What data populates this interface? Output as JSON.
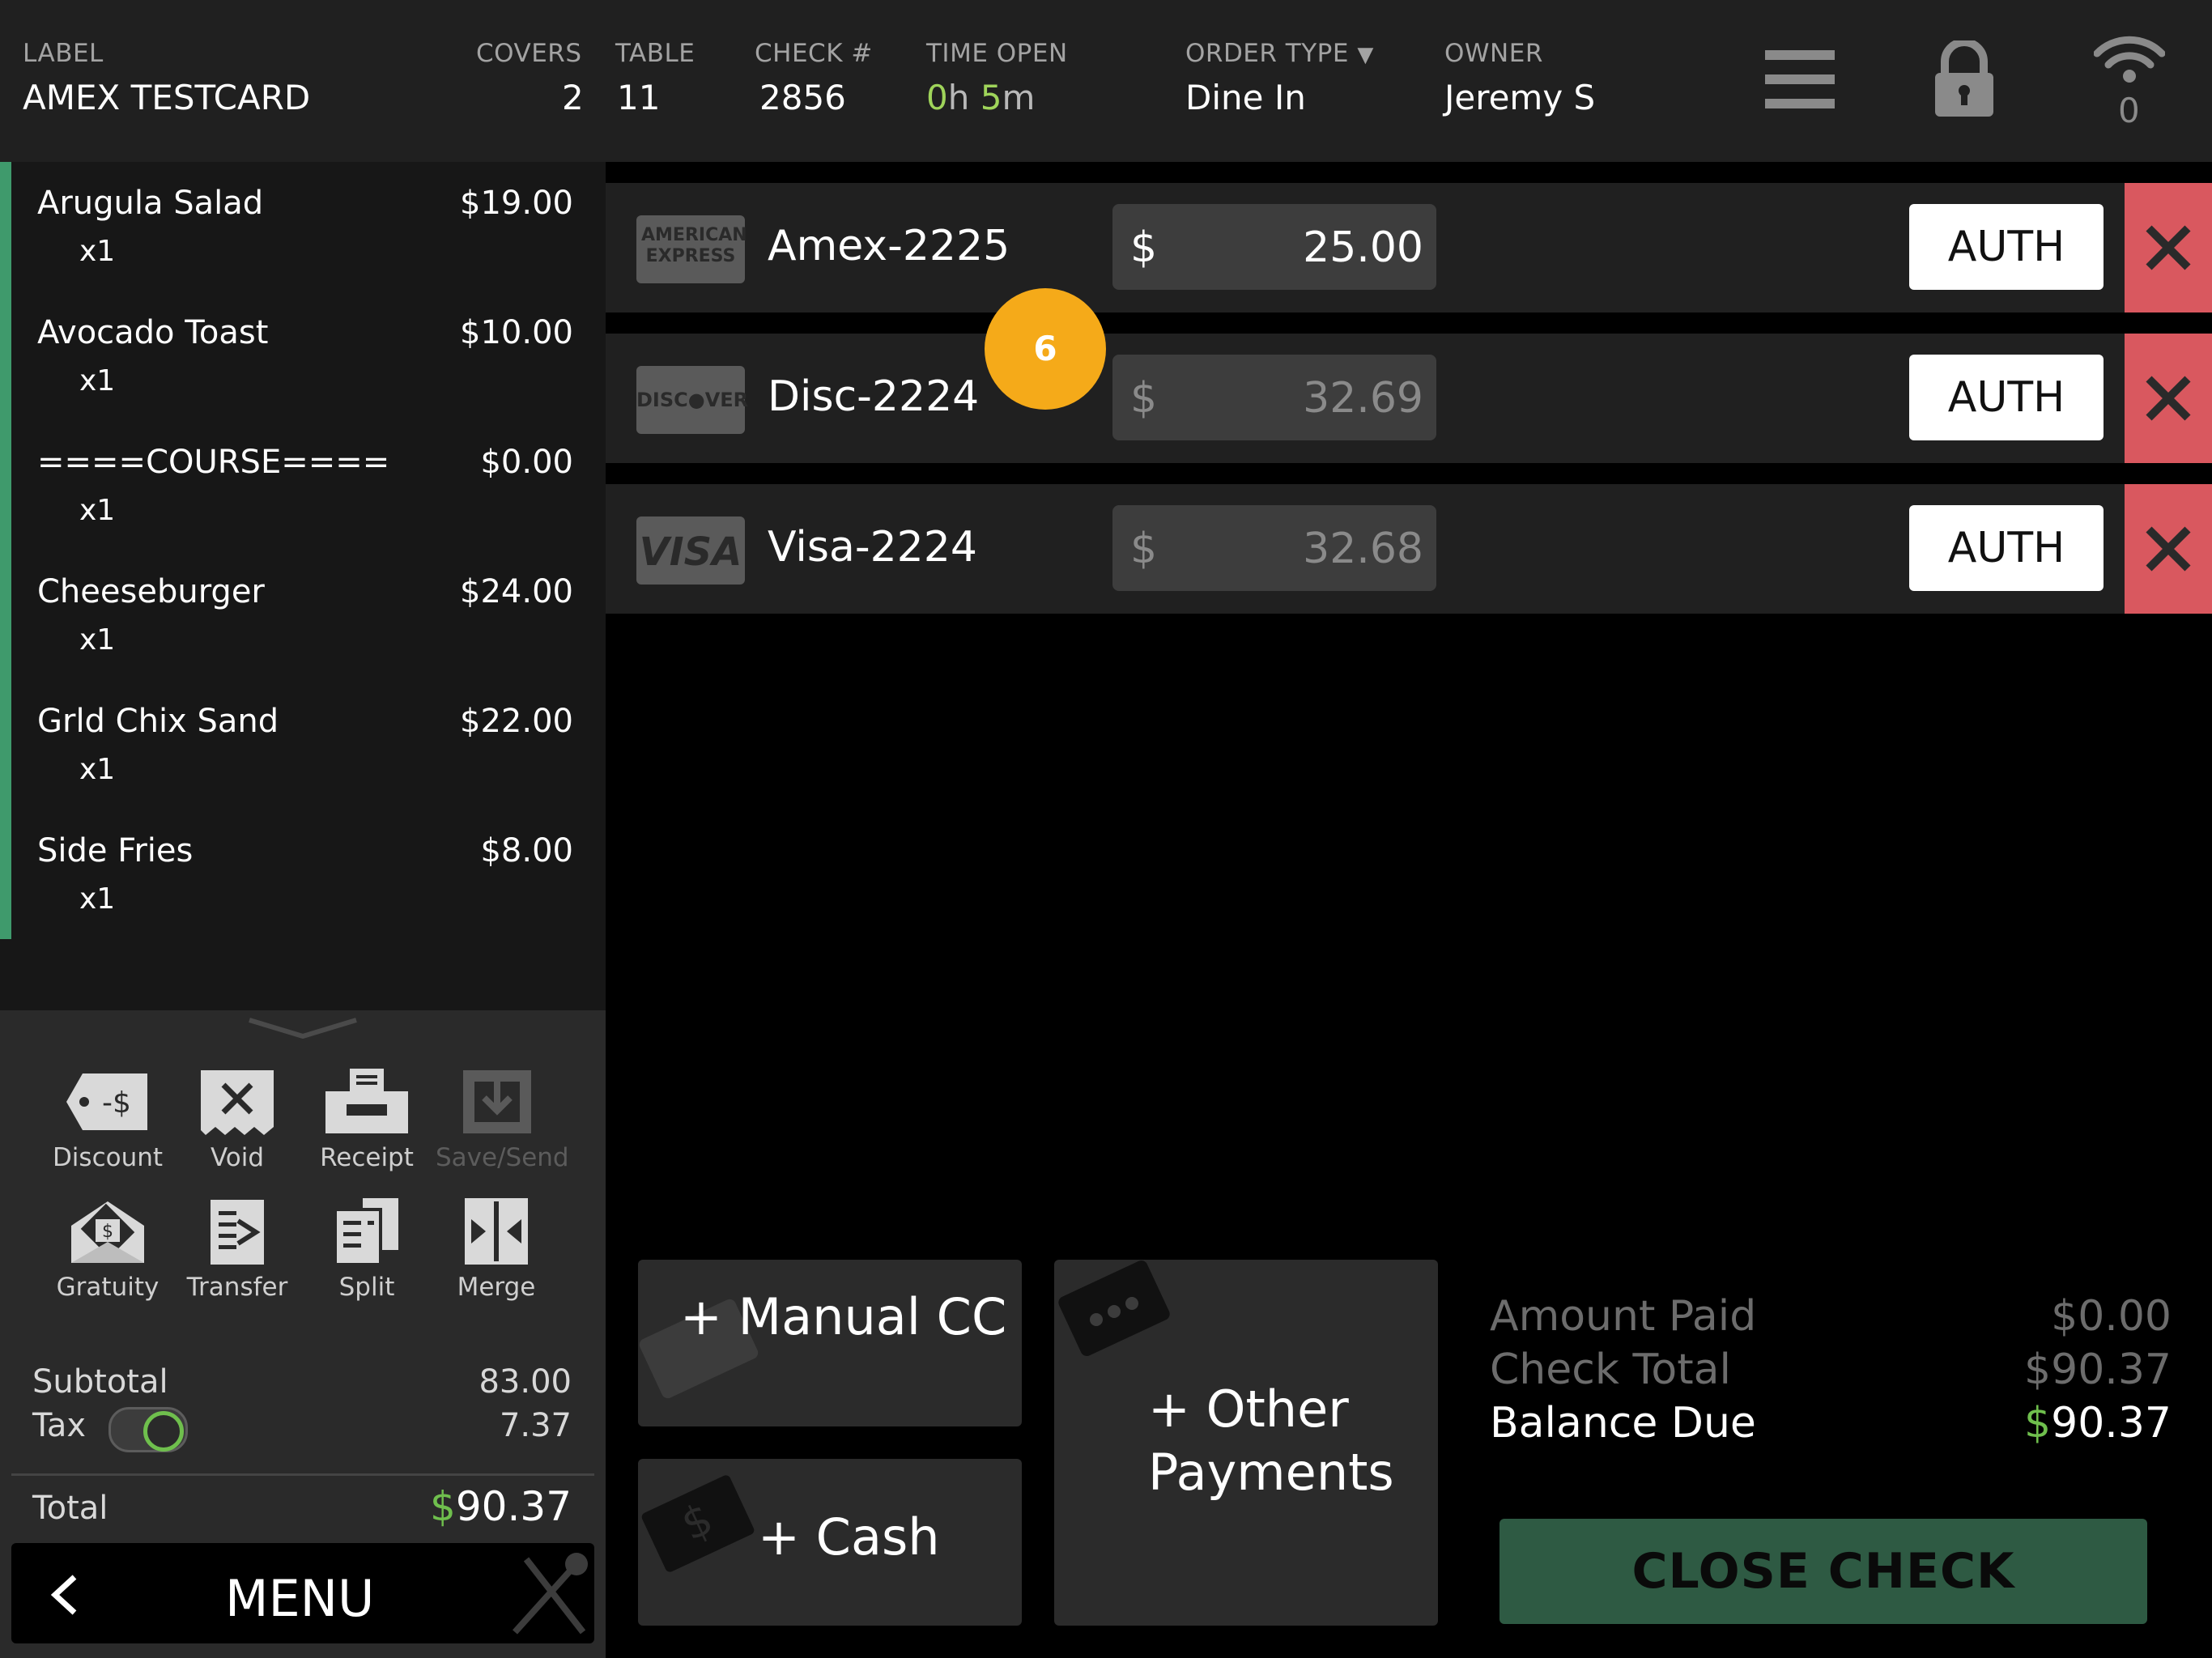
{
  "header": {
    "label_caption": "LABEL",
    "label_value": "AMEX TESTCARD",
    "covers_caption": "COVERS",
    "covers_value": "2",
    "table_caption": "TABLE",
    "table_value": "11",
    "check_caption": "CHECK #",
    "check_value": "2856",
    "time_caption": "TIME OPEN",
    "time_hours": "0",
    "time_h_unit": "h",
    "time_minutes": "5",
    "time_m_unit": "m",
    "order_type_caption": "ORDER TYPE",
    "order_type_value": "Dine In",
    "owner_caption": "OWNER",
    "owner_value": "Jeremy S",
    "wifi_count": "0",
    "icons": [
      "hamburger-menu-icon",
      "lock-icon",
      "wifi-icon"
    ]
  },
  "order_items": [
    {
      "name": "Arugula Salad",
      "price": "$19.00",
      "qty": "x1"
    },
    {
      "name": "Avocado Toast",
      "price": "$10.00",
      "qty": "x1"
    },
    {
      "name": "====COURSE====",
      "price": "$0.00",
      "qty": "x1"
    },
    {
      "name": "Cheeseburger",
      "price": "$24.00",
      "qty": "x1"
    },
    {
      "name": "Grld Chix Sand",
      "price": "$22.00",
      "qty": "x1"
    },
    {
      "name": "Side Fries",
      "price": "$8.00",
      "qty": "x1"
    }
  ],
  "actions": [
    {
      "label": "Discount",
      "icon": "discount-tag-icon",
      "discount_text": "-$"
    },
    {
      "label": "Void",
      "icon": "void-receipt-icon"
    },
    {
      "label": "Receipt",
      "icon": "printer-icon"
    },
    {
      "label": "Save/Send",
      "icon": "save-send-icon",
      "disabled": true
    },
    {
      "label": "Gratuity",
      "icon": "gratuity-envelope-icon"
    },
    {
      "label": "Transfer",
      "icon": "transfer-icon"
    },
    {
      "label": "Split",
      "icon": "split-icon"
    },
    {
      "label": "Merge",
      "icon": "merge-icon"
    }
  ],
  "totals": {
    "subtotal_label": "Subtotal",
    "subtotal_value": "83.00",
    "tax_label": "Tax",
    "tax_value": "7.37",
    "tax_enabled": true,
    "total_label": "Total",
    "total_currency": "$",
    "total_value": "90.37"
  },
  "menu_label": "MENU",
  "payments": [
    {
      "card": "Amex-2225",
      "logo": "american-express-logo",
      "logo_text": "AMERICAN EXPRESS",
      "currency": "$",
      "amount": "25.00",
      "active": true,
      "auth_label": "AUTH"
    },
    {
      "card": "Disc-2224",
      "logo": "discover-logo",
      "logo_text": "DISC●VER",
      "currency": "$",
      "amount": "32.69",
      "active": false,
      "auth_label": "AUTH"
    },
    {
      "card": "Visa-2224",
      "logo": "visa-logo",
      "logo_text": "VISA",
      "currency": "$",
      "amount": "32.68",
      "active": false,
      "auth_label": "AUTH"
    }
  ],
  "step_badge": "6",
  "payment_buttons": {
    "manual_cc": "+ Manual CC",
    "cash": "+ Cash",
    "other_line1": "+ Other",
    "other_line2": "Payments"
  },
  "summary": {
    "amount_paid_label": "Amount Paid",
    "amount_paid_value": "$0.00",
    "check_total_label": "Check Total",
    "check_total_value": "$90.37",
    "balance_due_label": "Balance Due",
    "balance_due_currency": "$",
    "balance_due_value": "90.37"
  },
  "close_check_label": "CLOSE CHECK",
  "colors": {
    "accent_green": "#6fbf4d",
    "order_accent": "#3f9a6c",
    "delete_red": "#d9585f",
    "badge_orange": "#f5aa19",
    "close_check_bg": "#2e5a43"
  }
}
